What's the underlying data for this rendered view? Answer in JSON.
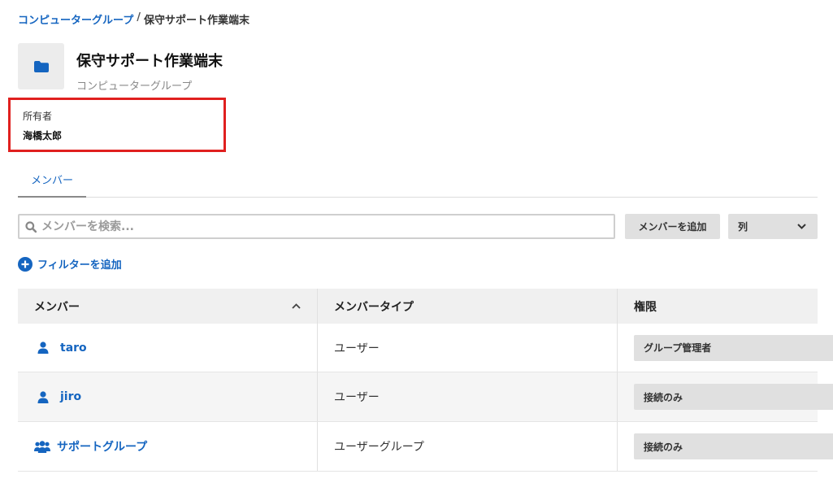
{
  "breadcrumb": {
    "parent": "コンピューターグループ",
    "separator": "/",
    "current": "保守サポート作業端末"
  },
  "header": {
    "title": "保守サポート作業端末",
    "subtitle": "コンピューターグループ",
    "icon": "folder-icon"
  },
  "owner": {
    "label": "所有者",
    "value": "海橋太郎"
  },
  "tabs": [
    {
      "label": "メンバー",
      "active": true
    }
  ],
  "search": {
    "placeholder": "メンバーを検索...",
    "value": ""
  },
  "toolbar": {
    "add_member_label": "メンバーを追加",
    "columns_label": "列"
  },
  "filter": {
    "add_filter_label": "フィルターを追加"
  },
  "table": {
    "columns": [
      "メンバー",
      "メンバータイプ",
      "権限"
    ],
    "sort": "ascending",
    "rows": [
      {
        "name": "taro",
        "type": "ユーザー",
        "permission": "グループ管理者",
        "icon": "user-icon"
      },
      {
        "name": "jiro",
        "type": "ユーザー",
        "permission": "接続のみ",
        "icon": "user-icon"
      },
      {
        "name": "サポートグループ",
        "type": "ユーザーグループ",
        "permission": "接続のみ",
        "icon": "users-icon"
      }
    ]
  },
  "colors": {
    "accent": "#1565c0",
    "highlight_border": "#e0201f",
    "header_background": "#f0f0f0",
    "button_background": "#e0e0e0"
  }
}
